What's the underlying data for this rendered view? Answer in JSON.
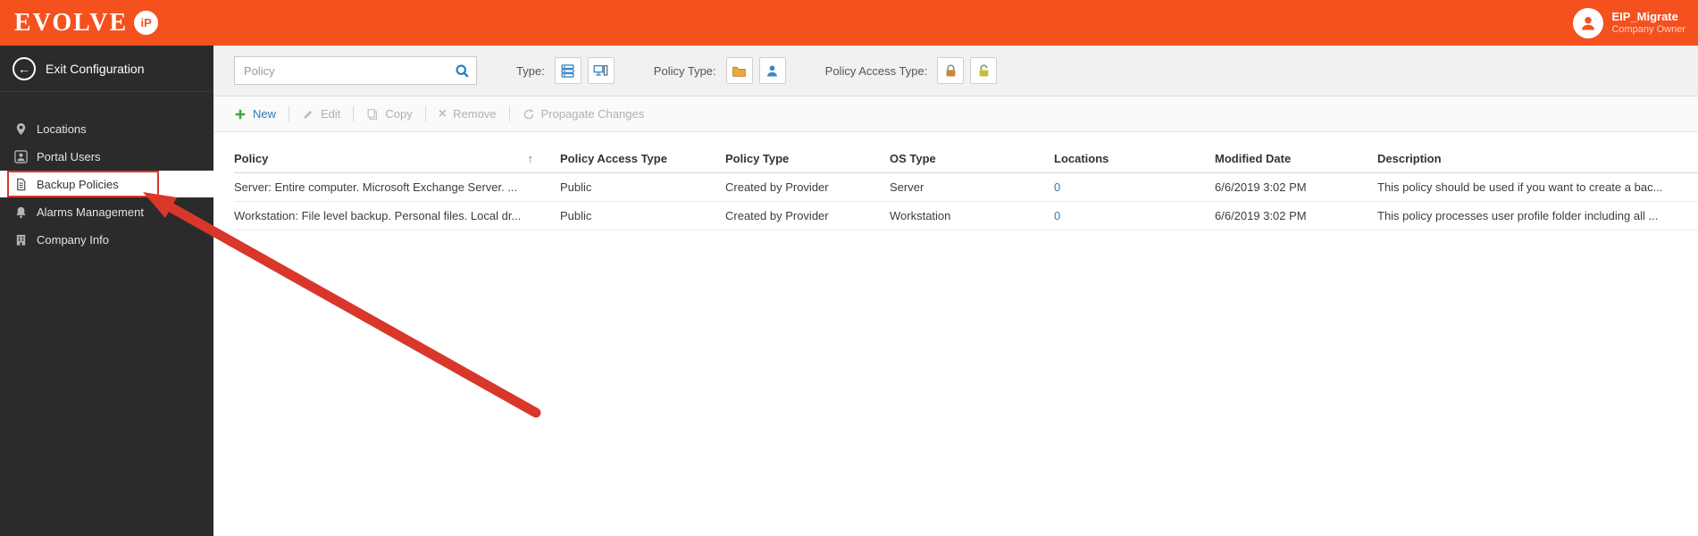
{
  "header": {
    "brand": "EVOLVE",
    "brand_badge": "iP",
    "user_name": "EIP_Migrate",
    "user_role": "Company Owner"
  },
  "sidebar": {
    "exit_label": "Exit Configuration",
    "items": [
      {
        "label": "Locations"
      },
      {
        "label": "Portal Users"
      },
      {
        "label": "Backup Policies"
      },
      {
        "label": "Alarms Management"
      },
      {
        "label": "Company Info"
      }
    ]
  },
  "filters": {
    "search_placeholder": "Policy",
    "type_label": "Type:",
    "policy_type_label": "Policy Type:",
    "policy_access_type_label": "Policy Access Type:"
  },
  "toolbar": {
    "new_label": "New",
    "edit_label": "Edit",
    "copy_label": "Copy",
    "remove_label": "Remove",
    "propagate_label": "Propagate Changes"
  },
  "table": {
    "columns": [
      "Policy",
      "Policy Access Type",
      "Policy Type",
      "OS Type",
      "Locations",
      "Modified Date",
      "Description"
    ],
    "rows": [
      {
        "policy": "Server: Entire computer. Microsoft Exchange Server. ...",
        "access": "Public",
        "type": "Created by Provider",
        "os": "Server",
        "locations": "0",
        "modified": "6/6/2019 3:02 PM",
        "description": "This policy should be used if you want to create a bac..."
      },
      {
        "policy": "Workstation: File level backup. Personal files. Local dr...",
        "access": "Public",
        "type": "Created by Provider",
        "os": "Workstation",
        "locations": "0",
        "modified": "6/6/2019 3:02 PM",
        "description": "This policy processes user profile folder including all ..."
      }
    ]
  },
  "icons": {
    "exit_arrow": "←",
    "remove_x": "×",
    "sort_ascending": "↑"
  },
  "colors": {
    "brand_orange": "#f4511e",
    "sidebar_dark": "#2b2b2b",
    "annotation_red": "#d9372a",
    "link_blue": "#2d7cb8",
    "success_green": "#43a047",
    "icon_blue": "#3c86c6"
  }
}
